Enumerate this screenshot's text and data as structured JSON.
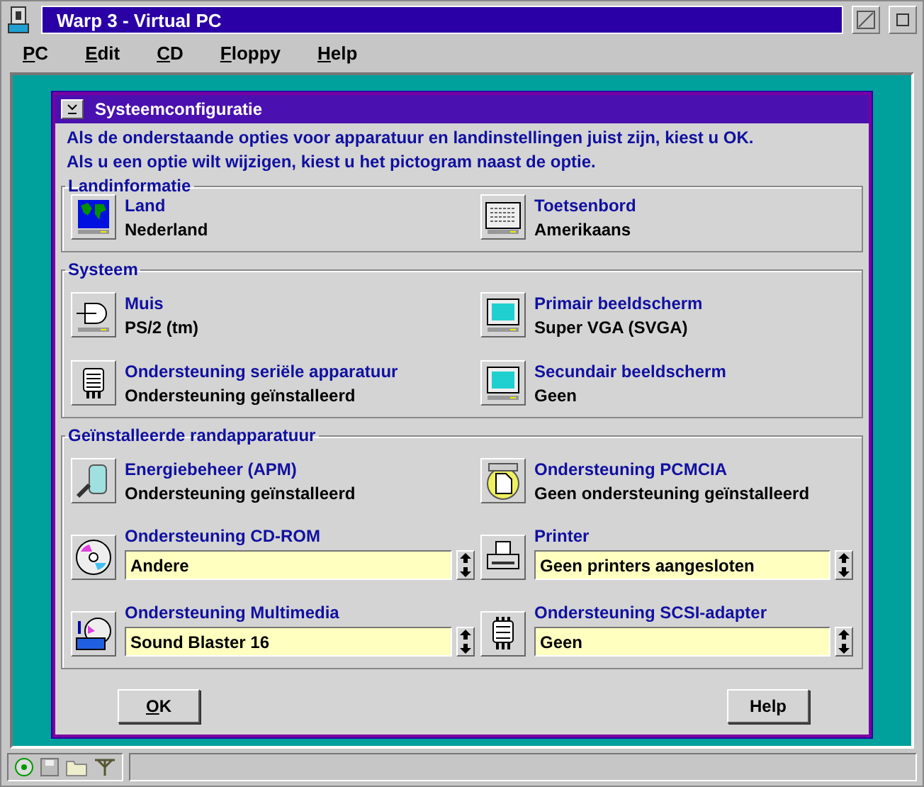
{
  "window": {
    "title": "Warp 3 - Virtual PC"
  },
  "menu": [
    "PC",
    "Edit",
    "CD",
    "Floppy",
    "Help"
  ],
  "dialog": {
    "title": "Systeemconfiguratie",
    "intro": [
      "Als de onderstaande opties voor apparatuur en landinstellingen juist zijn, kiest u OK.",
      "Als u een optie wilt wijzigen, kiest u het pictogram naast de optie."
    ],
    "groups": [
      {
        "title": "Landinformatie",
        "items": [
          {
            "kind": "text",
            "label": "Land",
            "value": "Nederland"
          },
          {
            "kind": "text",
            "label": "Toetsenbord",
            "value": "Amerikaans"
          }
        ]
      },
      {
        "title": "Systeem",
        "items": [
          {
            "kind": "text",
            "label": "Muis",
            "value": "PS/2 (tm)"
          },
          {
            "kind": "text",
            "label": "Primair beeldscherm",
            "value": "Super VGA (SVGA)"
          },
          {
            "kind": "text",
            "label": "Ondersteuning seriële apparatuur",
            "value": "Ondersteuning geïnstalleerd"
          },
          {
            "kind": "text",
            "label": "Secundair beeldscherm",
            "value": "Geen"
          }
        ]
      },
      {
        "title": "Geïnstalleerde randapparatuur",
        "items": [
          {
            "kind": "text",
            "label": "Energiebeheer (APM)",
            "value": "Ondersteuning geïnstalleerd"
          },
          {
            "kind": "text",
            "label": "Ondersteuning PCMCIA",
            "value": "Geen ondersteuning geïnstalleerd"
          },
          {
            "kind": "spin",
            "label": "Ondersteuning CD-ROM",
            "value": "Andere"
          },
          {
            "kind": "spin",
            "label": "Printer",
            "value": "Geen printers aangesloten"
          },
          {
            "kind": "spin",
            "label": "Ondersteuning Multimedia",
            "value": "Sound Blaster 16"
          },
          {
            "kind": "spin",
            "label": "Ondersteuning SCSI-adapter",
            "value": "Geen"
          }
        ]
      }
    ],
    "buttons": [
      "OK",
      "Help"
    ]
  }
}
